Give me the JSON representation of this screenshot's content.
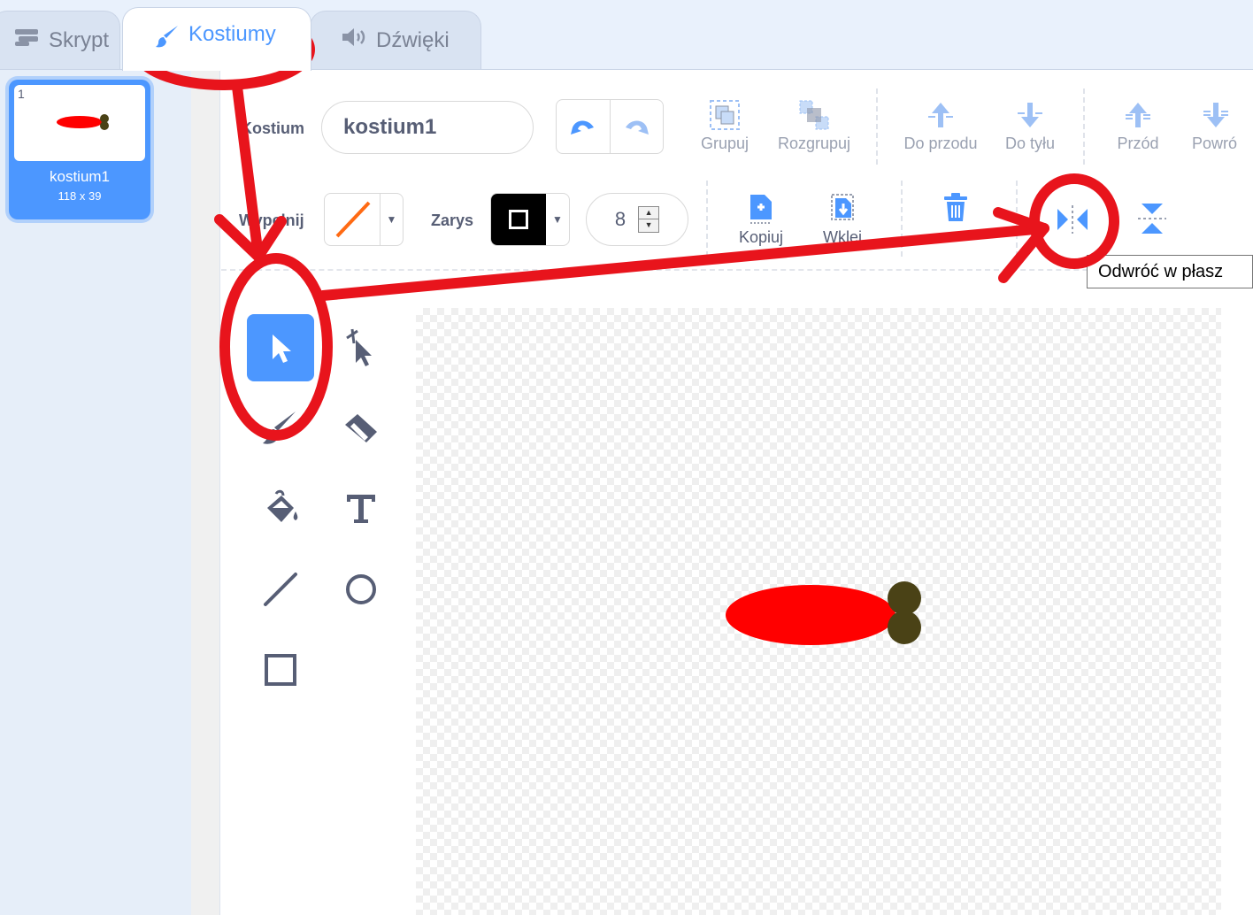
{
  "tabs": [
    {
      "label": "Skrypt",
      "icon": "code-blocks-icon"
    },
    {
      "label": "Kostiumy",
      "icon": "paintbrush-icon"
    },
    {
      "label": "Dźwięki",
      "icon": "speaker-icon"
    }
  ],
  "costume_list": [
    {
      "index": "1",
      "name": "kostium1",
      "size": "118 x 39"
    }
  ],
  "toolbar": {
    "costume_label": "Kostium",
    "costume_name": "kostium1",
    "group_label": "Grupuj",
    "ungroup_label": "Rozgrupuj",
    "forward_label": "Do przodu",
    "backward_label": "Do tyłu",
    "front_label": "Przód",
    "back_label": "Powró",
    "fill_label": "Wypełnij",
    "outline_label": "Zarys",
    "outline_width": "8",
    "copy_label": "Kopiuj",
    "paste_label": "Wklej",
    "tooltip": "Odwróć w płasz"
  },
  "tools": [
    {
      "name": "select-tool",
      "icon": "arrow-cursor-icon",
      "selected": true
    },
    {
      "name": "reshape-tool",
      "icon": "reshape-cursor-icon",
      "selected": false
    },
    {
      "name": "brush-tool",
      "icon": "brush-icon",
      "selected": false
    },
    {
      "name": "eraser-tool",
      "icon": "eraser-icon",
      "selected": false
    },
    {
      "name": "fill-tool",
      "icon": "paint-bucket-icon",
      "selected": false
    },
    {
      "name": "text-tool",
      "icon": "text-icon",
      "selected": false
    },
    {
      "name": "line-tool",
      "icon": "line-icon",
      "selected": false
    },
    {
      "name": "circle-tool",
      "icon": "circle-icon",
      "selected": false
    },
    {
      "name": "rectangle-tool",
      "icon": "rectangle-icon",
      "selected": false
    }
  ],
  "colors": {
    "accent": "#4c97ff",
    "annotation": "#e8141c",
    "sprite_body": "#ff0000",
    "sprite_head": "#4a4216",
    "fill_swatch": "#ff6a13"
  }
}
